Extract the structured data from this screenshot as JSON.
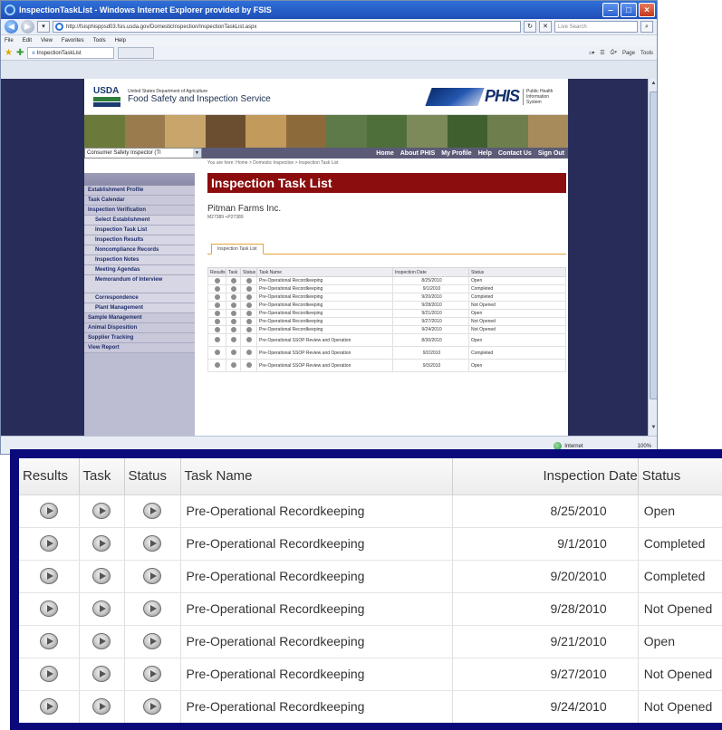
{
  "browser": {
    "title": "InspectionTaskList - Windows Internet Explorer provided by FSIS",
    "address": "http://fsisphisppsd03.fsis.usda.gov/DomesticInspection/InspectionTaskList.aspx",
    "search_placeholder": "Live Search",
    "menu": [
      "File",
      "Edit",
      "View",
      "Favorites",
      "Tools",
      "Help"
    ],
    "tab_label": "InspectionTaskList",
    "toolbar_right": [
      "Page",
      "Tools"
    ],
    "status_zone": "Internet",
    "zoom": "100%"
  },
  "header": {
    "usda": "USDA",
    "dept": "United States Department of Agriculture",
    "agency": "Food Safety and Inspection Service",
    "phis_logo": "PHIS",
    "phis_sub": "Public Health Information System"
  },
  "colors": {
    "banner": [
      "#6b7a3a",
      "#9a7b4e",
      "#c8a56a",
      "#6a4e2f",
      "#c29a5b",
      "#8c6a3a",
      "#5d7a48",
      "#4f6f3a",
      "#7c8a5a",
      "#3f5f2f",
      "#6e7f4d",
      "#a88b5a"
    ]
  },
  "nav": {
    "role_select": "Consumer Safety Inspector (TI",
    "top_links": [
      "Home",
      "About PHIS",
      "My Profile",
      "Help",
      "Contact Us",
      "Sign Out"
    ],
    "breadcrumb": "You are here: Home > Domestic Inspection > Inspection Task List"
  },
  "sidebar": {
    "items": [
      {
        "label": "Establishment Profile",
        "sub": false
      },
      {
        "label": "Task Calendar",
        "sub": false
      },
      {
        "label": "Inspection Verification",
        "sub": false
      },
      {
        "label": "Select Establishment",
        "sub": true
      },
      {
        "label": "Inspection Task List",
        "sub": true
      },
      {
        "label": "Inspection Results",
        "sub": true
      },
      {
        "label": "Noncompliance Records",
        "sub": true
      },
      {
        "label": "Inspection Notes",
        "sub": true
      },
      {
        "label": "Meeting Agendas",
        "sub": true
      },
      {
        "label": "Memorandum of Interview",
        "sub": true
      },
      {
        "label": "Correspondence",
        "sub": true
      },
      {
        "label": "Plant Management",
        "sub": true
      },
      {
        "label": "Sample Management",
        "sub": false
      },
      {
        "label": "Animal Disposition",
        "sub": false
      },
      {
        "label": "Supplier Tracking",
        "sub": false
      },
      {
        "label": "View Report",
        "sub": false
      }
    ]
  },
  "main": {
    "title": "Inspection Task List",
    "establishment": "Pitman Farms Inc.",
    "est_number": "M27389 +P27389",
    "tab": "Inspection Task List"
  },
  "table": {
    "headers": [
      "Results",
      "Task",
      "Status",
      "Task Name",
      "Inspection Date",
      "Status"
    ],
    "rows": [
      [
        "Pre-Operational Recordkeeping",
        "8/25/2010",
        "Open"
      ],
      [
        "Pre-Operational Recordkeeping",
        "9/1/2010",
        "Completed"
      ],
      [
        "Pre-Operational Recordkeeping",
        "9/20/2010",
        "Completed"
      ],
      [
        "Pre-Operational Recordkeeping",
        "9/28/2010",
        "Not Opened"
      ],
      [
        "Pre-Operational Recordkeeping",
        "9/21/2010",
        "Open"
      ],
      [
        "Pre-Operational Recordkeeping",
        "9/27/2010",
        "Not Opened"
      ],
      [
        "Pre-Operational Recordkeeping",
        "9/24/2010",
        "Not Opened"
      ],
      [
        "Pre-Operational SSOP Review and Operation",
        "8/30/2010",
        "Open"
      ],
      [
        "Pre-Operational SSOP Review and Operation",
        "9/2/2010",
        "Completed"
      ],
      [
        "Pre-Operational SSOP Review and Operation",
        "9/3/2010",
        "Open"
      ]
    ]
  },
  "zoom_table": {
    "headers": [
      "Results",
      "Task",
      "Status",
      "Task Name",
      "Inspection Date",
      "Status"
    ],
    "rows": [
      [
        "Pre-Operational Recordkeeping",
        "8/25/2010",
        "Open"
      ],
      [
        "Pre-Operational Recordkeeping",
        "9/1/2010",
        "Completed"
      ],
      [
        "Pre-Operational Recordkeeping",
        "9/20/2010",
        "Completed"
      ],
      [
        "Pre-Operational Recordkeeping",
        "9/28/2010",
        "Not Opened"
      ],
      [
        "Pre-Operational Recordkeeping",
        "9/21/2010",
        "Open"
      ],
      [
        "Pre-Operational Recordkeeping",
        "9/27/2010",
        "Not Opened"
      ],
      [
        "Pre-Operational Recordkeeping",
        "9/24/2010",
        "Not Opened"
      ]
    ]
  }
}
